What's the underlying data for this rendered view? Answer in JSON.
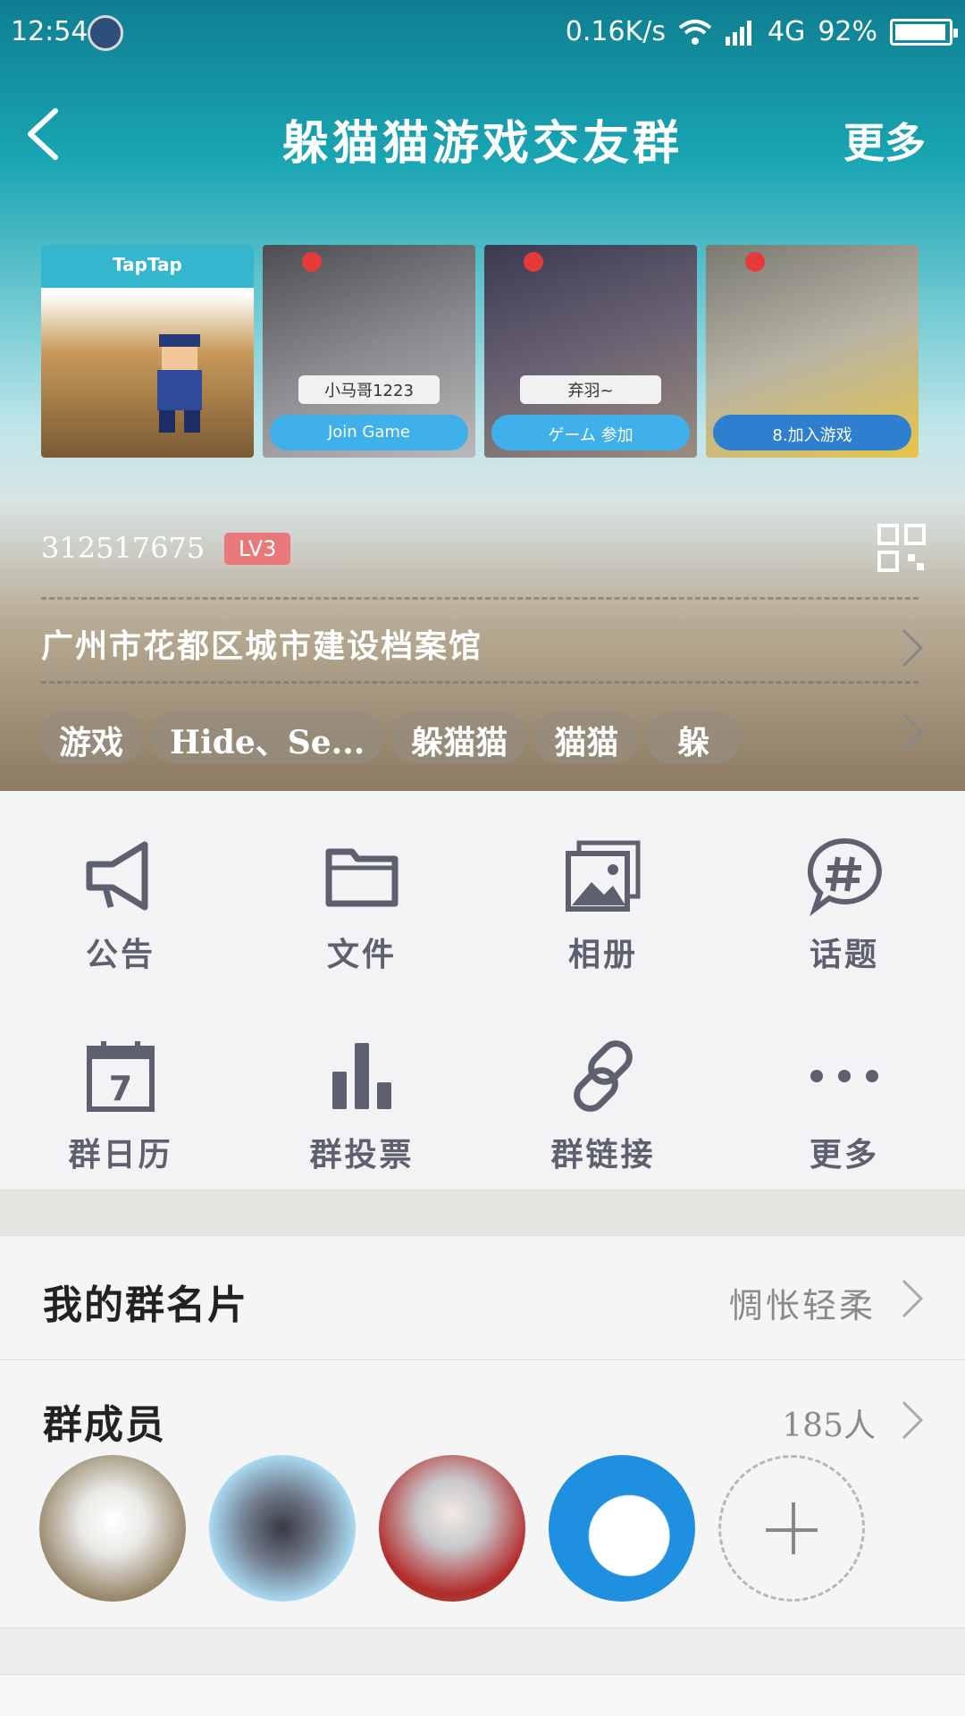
{
  "status_bar": {
    "time": "12:54",
    "net_speed": "0.16K/s",
    "network": "4G",
    "battery": "92%",
    "battery_level": 0.92,
    "icons": [
      "shield-icon",
      "wifi-icon",
      "signal-icon",
      "battery-icon"
    ]
  },
  "nav": {
    "back_icon": "chevron-left-icon",
    "title": "躲猫猫游戏交友群",
    "more_label": "更多"
  },
  "photos": [
    {
      "header": "TapTap",
      "caption": ""
    },
    {
      "header": "",
      "caption": "Join Game",
      "name": "小马哥1223"
    },
    {
      "header": "",
      "caption": "ゲーム 参加",
      "name": "弃羽~"
    },
    {
      "header": "",
      "caption": "8.加入游戏",
      "name": ""
    }
  ],
  "group": {
    "id": "312517675",
    "level": "LV3",
    "location": "广州市花都区城市建设档案馆",
    "tags": [
      "游戏",
      "Hide、Se...",
      "躲猫猫",
      "猫猫",
      "躲"
    ]
  },
  "features": [
    {
      "label": "公告",
      "icon": "megaphone-icon"
    },
    {
      "label": "文件",
      "icon": "folder-icon"
    },
    {
      "label": "相册",
      "icon": "photo-album-icon"
    },
    {
      "label": "话题",
      "icon": "hashtag-bubble-icon"
    },
    {
      "label": "群日历",
      "icon": "calendar-icon",
      "icon_text": "7"
    },
    {
      "label": "群投票",
      "icon": "bar-chart-icon"
    },
    {
      "label": "群链接",
      "icon": "link-icon"
    },
    {
      "label": "更多",
      "icon": "more-dots-icon"
    }
  ],
  "my_card": {
    "label": "我的群名片",
    "value": "惆怅轻柔"
  },
  "members": {
    "label": "群成员",
    "count": "185人",
    "avatar_count": 4,
    "add_icon": "plus-icon"
  },
  "colors": {
    "header_top": "#0f7e92",
    "level_badge": "#e8787a",
    "icon_gray": "#5e6070"
  }
}
